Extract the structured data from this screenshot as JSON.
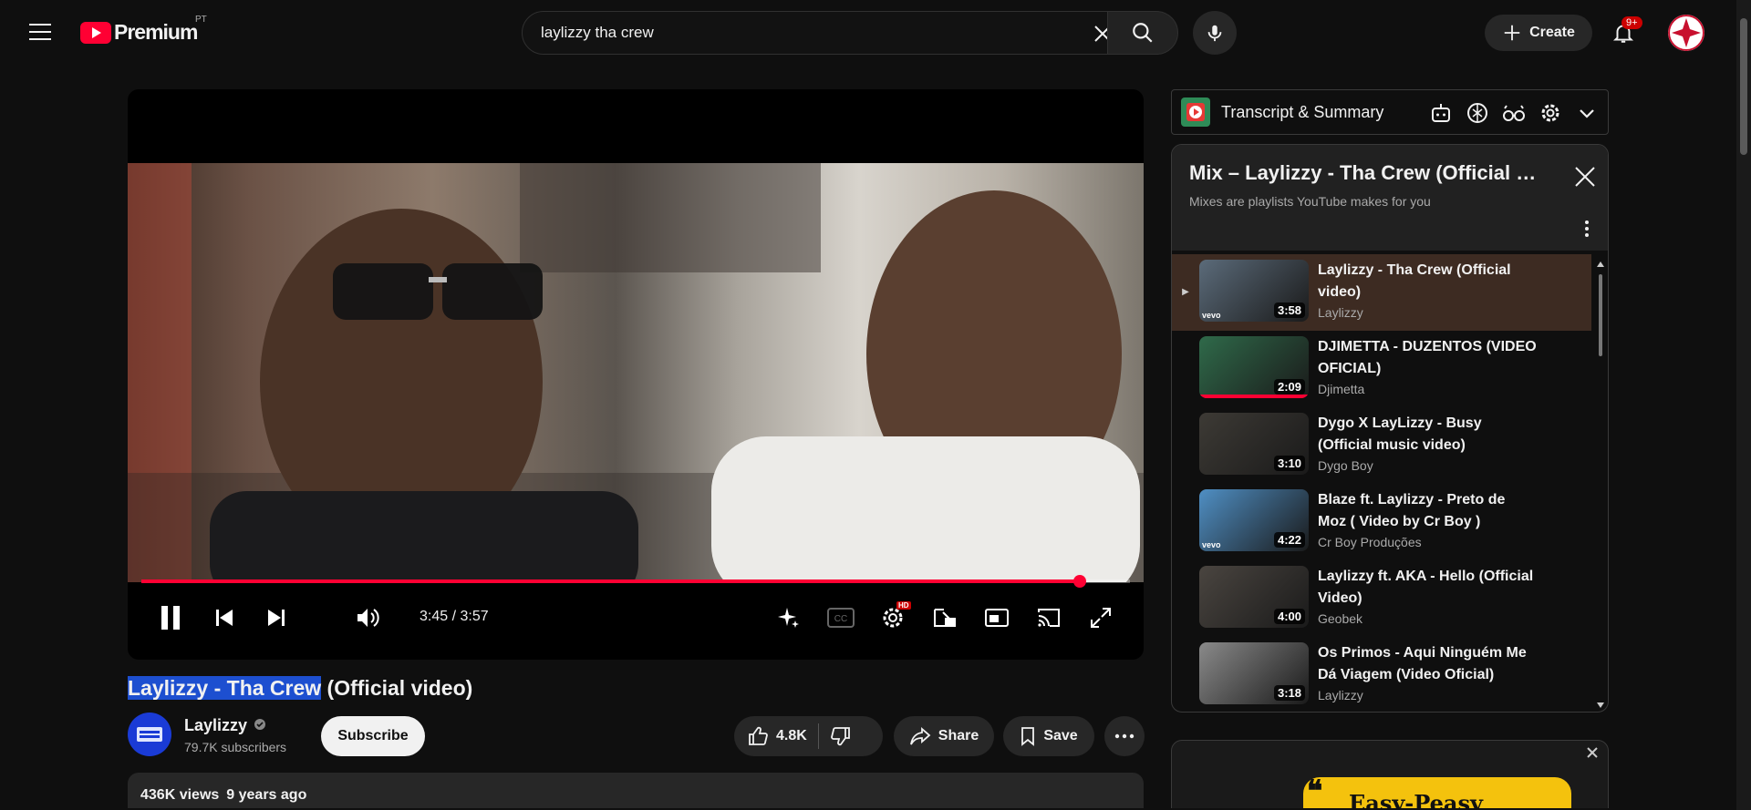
{
  "header": {
    "brand": "Premium",
    "region": "PT",
    "search_value": "laylizzy tha crew",
    "create_label": "Create",
    "notifications_badge": "9+"
  },
  "player": {
    "current_time": "3:45",
    "duration": "3:57",
    "time_display": "3:45 / 3:57",
    "progress_fraction": 0.949,
    "hd_badge": "HD",
    "cc_label": "CC"
  },
  "video": {
    "title_highlighted": "Laylizzy - Tha Crew",
    "title_rest": " (Official video)",
    "channel_name": "Laylizzy",
    "subscribers": "79.7K subscribers",
    "subscribe_label": "Subscribe",
    "likes": "4.8K",
    "share_label": "Share",
    "save_label": "Save",
    "views": "436K views",
    "uploaded": "9 years ago"
  },
  "transcript": {
    "label": "Transcript & Summary"
  },
  "mix": {
    "title": "Mix – Laylizzy - Tha Crew (Official video)",
    "subtitle": "Mixes are playlists YouTube makes for you",
    "items": [
      {
        "title": "Laylizzy - Tha Crew (Official video)",
        "channel": "Laylizzy",
        "duration": "3:58",
        "vevo": "vevo",
        "active": true
      },
      {
        "title": "DJIMETTA - DUZENTOS (VIDEO OFICIAL)",
        "channel": "Djimetta",
        "duration": "2:09",
        "watched": 1.0
      },
      {
        "title": "Dygo X LayLizzy - Busy (Official music video)",
        "channel": "Dygo Boy",
        "duration": "3:10"
      },
      {
        "title": "Blaze ft. Laylizzy - Preto de Moz ( Video by Cr Boy )",
        "channel": "Cr Boy Produções",
        "duration": "4:22",
        "vevo": "vevo"
      },
      {
        "title": "Laylizzy ft. AKA - Hello (Official Video)",
        "channel": "Geobek",
        "duration": "4:00"
      },
      {
        "title": "Os Primos - Aqui Ninguém Me Dá Viagem (Video Oficial)",
        "channel": "Laylizzy",
        "duration": "3:18"
      }
    ]
  },
  "ad": {
    "banner_text": "Easy-Peasy"
  }
}
